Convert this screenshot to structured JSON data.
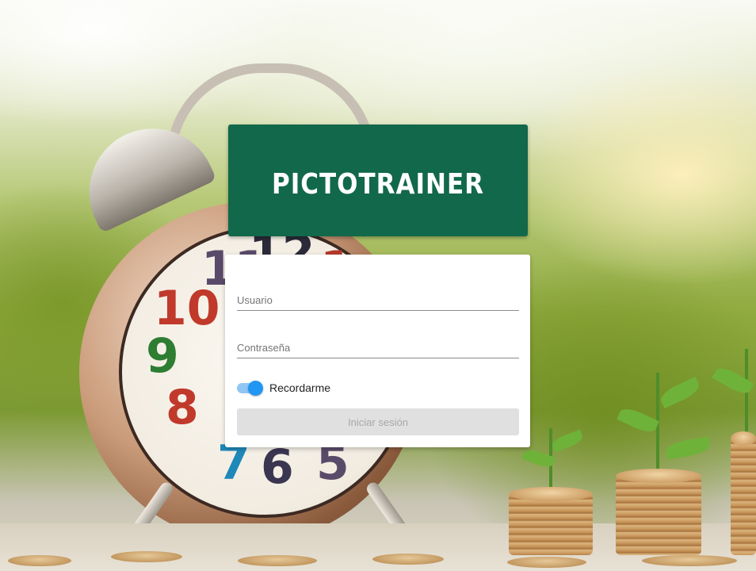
{
  "brand": {
    "title": "PictoTrainer",
    "background_color": "#12684a"
  },
  "login_form": {
    "username_placeholder": "Usuario",
    "password_placeholder": "Contraseña",
    "remember_label": "Recordarme",
    "remember_checked": true,
    "submit_label": "Iniciar sesión",
    "submit_enabled": false
  },
  "colors": {
    "toggle_accent": "#2196f3",
    "card_background": "#ffffff"
  },
  "background_image": {
    "clock_numerals": [
      "11",
      "12",
      "1",
      "10",
      "9",
      "8",
      "7",
      "6",
      "5"
    ]
  }
}
